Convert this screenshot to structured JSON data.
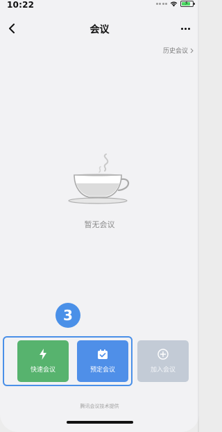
{
  "status_bar": {
    "time": "10:22"
  },
  "nav": {
    "title": "会议",
    "back_icon": "chevron-left-icon",
    "more_icon": "more-dots-icon"
  },
  "history_link": {
    "label": "历史会议",
    "icon": "chevron-right-icon"
  },
  "empty_state": {
    "icon": "coffee-cup-icon",
    "text": "暂无会议"
  },
  "tutorial": {
    "step_number": "3",
    "accent_color": "#4a90e8"
  },
  "actions": [
    {
      "label": "快速会议",
      "icon": "lightning-icon",
      "color": "#57b36e"
    },
    {
      "label": "预定会议",
      "icon": "calendar-check-icon",
      "color": "#4f8fe8"
    },
    {
      "label": "加入会议",
      "icon": "plus-circle-icon",
      "color": "#c3cbd6"
    }
  ],
  "footer": {
    "text": "腾讯会议技术提供"
  }
}
